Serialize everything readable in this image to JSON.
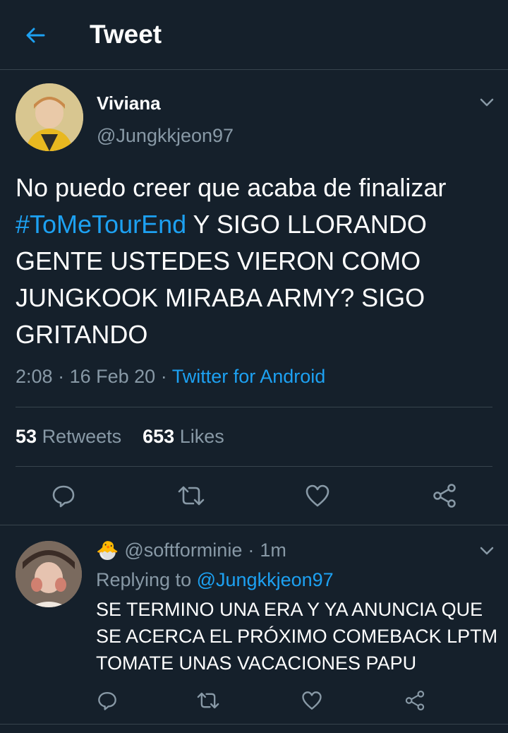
{
  "header": {
    "title": "Tweet"
  },
  "tweet": {
    "author_name": "Viviana",
    "author_handle": "@Jungkkjeon97",
    "text_before": "No puedo creer que acaba de finalizar ",
    "hashtag": "#ToMeTourEnd",
    "text_after": " Y SIGO LLORANDO GENTE USTEDES VIERON COMO JUNGKOOK MIRABA ARMY? SIGO GRITANDO",
    "time": "2:08",
    "date": "16 Feb 20",
    "separator": "·",
    "source": "Twitter for Android",
    "retweets_count": "53",
    "retweets_label": "Retweets",
    "likes_count": "653",
    "likes_label": "Likes"
  },
  "reply": {
    "badge_emoji": "🐣",
    "handle": "@softforminie",
    "separator": "·",
    "time": "1m",
    "replying_label": "Replying to",
    "replying_handle": "@Jungkkjeon97",
    "text": "SE TERMINO UNA ERA Y YA ANUNCIA QUE SE ACERCA EL PRÓXIMO COMEBACK LPTM TOMATE UNAS VACACIONES PAPU"
  },
  "colors": {
    "background": "#15202b",
    "accent": "#1da1f2",
    "secondary_text": "#8899a6",
    "border": "#38444d"
  },
  "icons": [
    "back-arrow-icon",
    "chevron-down-icon",
    "reply-icon",
    "retweet-icon",
    "like-icon",
    "share-icon"
  ]
}
